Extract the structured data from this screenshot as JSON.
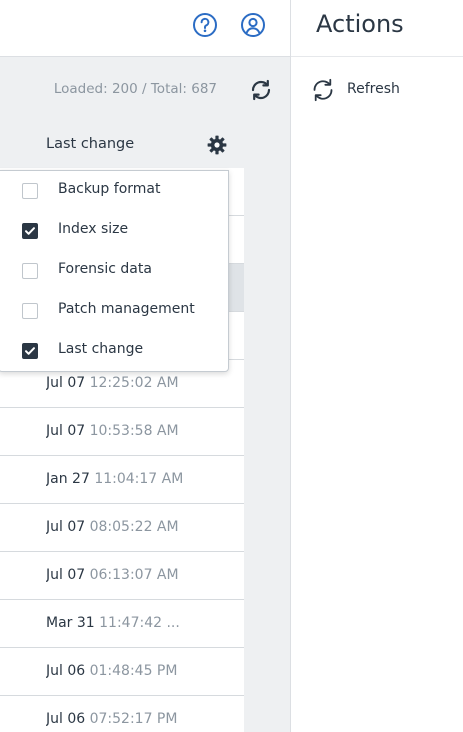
{
  "toolbar": {
    "help_icon": "question-circle-icon",
    "account_icon": "user-circle-icon"
  },
  "list": {
    "status": "Loaded: 200 / Total: 687",
    "column_header": "Last change",
    "rows": [
      {
        "date": "",
        "time": ""
      },
      {
        "date": "",
        "time": ""
      },
      {
        "date": "",
        "time": ""
      },
      {
        "date": "",
        "time": ""
      },
      {
        "date": "Jul 07",
        "time": "12:25:02 AM"
      },
      {
        "date": "Jul 07",
        "time": "10:53:58 AM"
      },
      {
        "date": "Jan 27",
        "time": "11:04:17 AM"
      },
      {
        "date": "Jul 07",
        "time": "08:05:22 AM"
      },
      {
        "date": "Jul 07",
        "time": "06:13:07 AM"
      },
      {
        "date": "Mar 31",
        "time": "11:47:42 ..."
      },
      {
        "date": "Jul 06",
        "time": "01:48:45 PM"
      },
      {
        "date": "Jul 06",
        "time": "07:52:17 PM"
      }
    ]
  },
  "column_menu": {
    "options": [
      {
        "label": "Backup format",
        "checked": false
      },
      {
        "label": "Index size",
        "checked": true
      },
      {
        "label": "Forensic data",
        "checked": false
      },
      {
        "label": "Patch management",
        "checked": false
      },
      {
        "label": "Last change",
        "checked": true
      }
    ]
  },
  "actions_panel": {
    "title": "Actions",
    "refresh_label": "Refresh"
  },
  "colors": {
    "accent": "#2b6cc4",
    "text": "#2b3744",
    "muted": "#8c96a0"
  }
}
